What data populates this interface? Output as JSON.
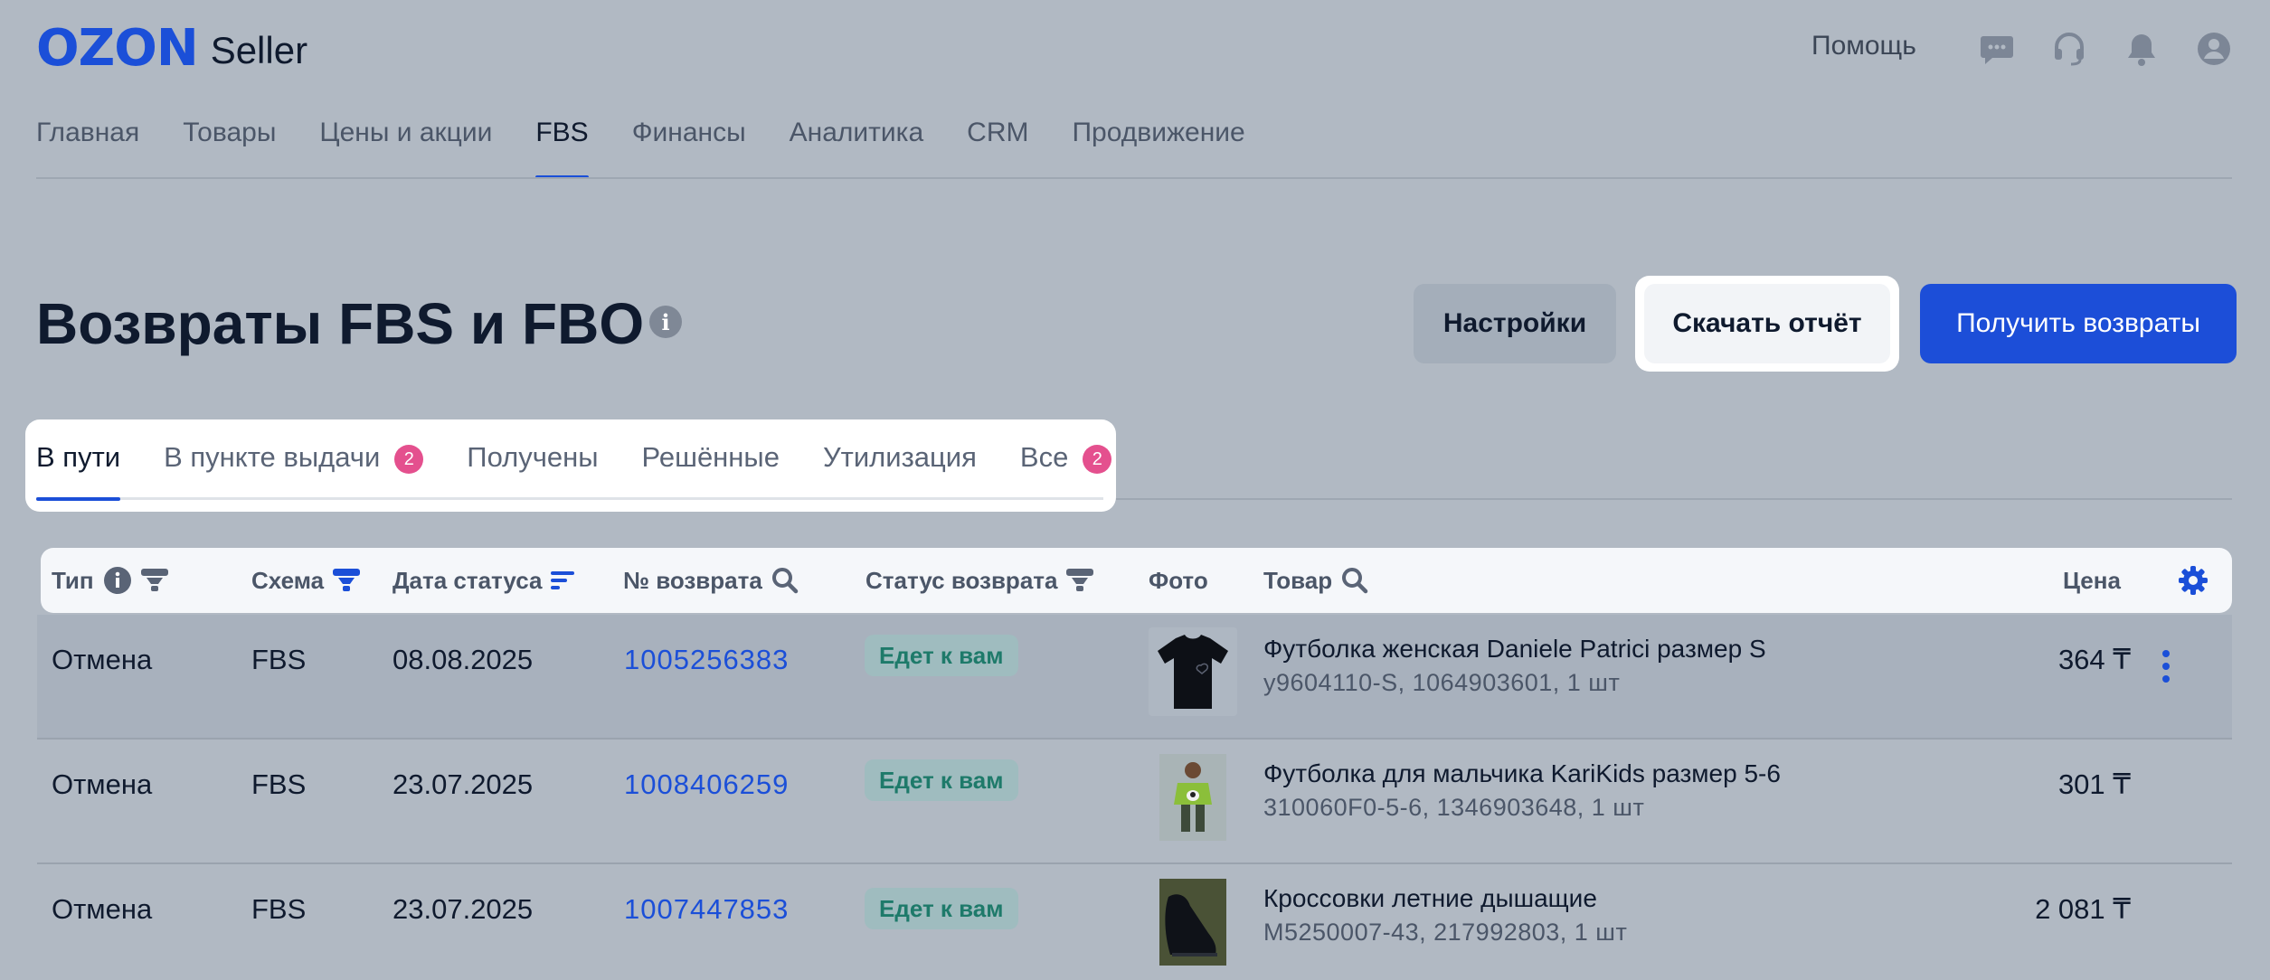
{
  "brand": {
    "logo": "OZON",
    "product": "Seller",
    "accent": "#1b4fd8"
  },
  "header": {
    "help": "Помощь",
    "icons": [
      "chat-icon",
      "headset-icon",
      "bell-icon",
      "user-icon"
    ]
  },
  "nav": {
    "items": [
      {
        "label": "Главная"
      },
      {
        "label": "Товары"
      },
      {
        "label": "Цены и акции"
      },
      {
        "label": "FBS",
        "active": true
      },
      {
        "label": "Финансы"
      },
      {
        "label": "Аналитика"
      },
      {
        "label": "CRM"
      },
      {
        "label": "Продвижение"
      }
    ]
  },
  "page": {
    "title": "Возвраты FBS и FBO",
    "buttons": {
      "settings": "Настройки",
      "download": "Скачать отчёт",
      "get_returns": "Получить возвраты"
    }
  },
  "tabs": [
    {
      "label": "В пути",
      "active": true
    },
    {
      "label": "В пункте выдачи",
      "badge": "2"
    },
    {
      "label": "Получены"
    },
    {
      "label": "Решённые"
    },
    {
      "label": "Утилизация"
    },
    {
      "label": "Все",
      "badge": "2"
    }
  ],
  "table": {
    "columns": {
      "type": "Тип",
      "scheme": "Схема",
      "status_date": "Дата статуса",
      "return_no": "№ возврата",
      "return_status": "Статус возврата",
      "photo": "Фото",
      "product": "Товар",
      "price": "Цена"
    },
    "rows": [
      {
        "type": "Отмена",
        "scheme": "FBS",
        "date": "08.08.2025",
        "return_no": "1005256383",
        "status": "Едет к вам",
        "product": "Футболка женская Daniele Patrici размер S",
        "sku": "у9604110-S, 1064903601, 1 шт",
        "price": "364 ₸"
      },
      {
        "type": "Отмена",
        "scheme": "FBS",
        "date": "23.07.2025",
        "return_no": "1008406259",
        "status": "Едет к вам",
        "product": "Футболка для мальчика KariKids размер 5-6",
        "sku": "310060F0-5-6, 1346903648, 1 шт",
        "price": "301 ₸"
      },
      {
        "type": "Отмена",
        "scheme": "FBS",
        "date": "23.07.2025",
        "return_no": "1007447853",
        "status": "Едет к вам",
        "product": "Кроссовки летние дышащие",
        "sku": "M5250007-43, 217992803, 1 шт",
        "price": "2 081 ₸"
      }
    ]
  }
}
